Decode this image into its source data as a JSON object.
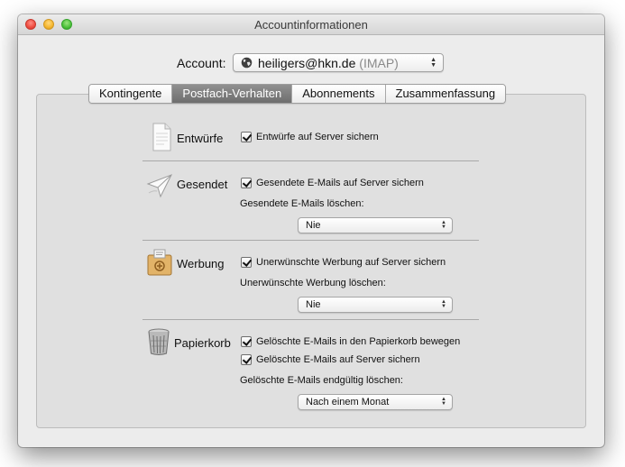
{
  "window": {
    "title": "Accountinformationen"
  },
  "account": {
    "label": "Account:",
    "email": "heiligers@hkn.de",
    "type": "(IMAP)",
    "icon": "globe-icon"
  },
  "tabs": [
    {
      "label": "Kontingente",
      "active": false
    },
    {
      "label": "Postfach-Verhalten",
      "active": true
    },
    {
      "label": "Abonnements",
      "active": false
    },
    {
      "label": "Zusammenfassung",
      "active": false
    }
  ],
  "sections": {
    "drafts": {
      "title": "Entwürfe",
      "icon": "document-icon",
      "store_on_server": {
        "label": "Entwürfe auf Server sichern",
        "checked": true
      }
    },
    "sent": {
      "title": "Gesendet",
      "icon": "paper-plane-icon",
      "store_on_server": {
        "label": "Gesendete E-Mails auf Server sichern",
        "checked": true
      },
      "delete_label": "Gesendete E-Mails löschen:",
      "delete_value": "Nie"
    },
    "junk": {
      "title": "Werbung",
      "icon": "junk-box-icon",
      "store_on_server": {
        "label": "Unerwünschte Werbung auf Server sichern",
        "checked": true
      },
      "delete_label": "Unerwünschte Werbung löschen:",
      "delete_value": "Nie"
    },
    "trash": {
      "title": "Papierkorb",
      "icon": "trash-can-icon",
      "move_to_trash": {
        "label": "Gelöschte E-Mails in den Papierkorb bewegen",
        "checked": true
      },
      "store_on_server": {
        "label": "Gelöschte E-Mails auf Server sichern",
        "checked": true
      },
      "delete_label": "Gelöschte E-Mails endgültig löschen:",
      "delete_value": "Nach einem Monat"
    }
  }
}
